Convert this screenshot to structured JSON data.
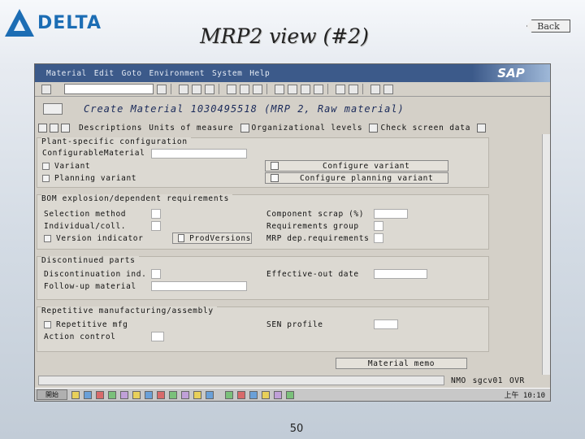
{
  "slide": {
    "logo_text": "DELTA",
    "title": "MRP2 view (#2)",
    "back_label": "Back",
    "page_number": "50"
  },
  "sap": {
    "menu": [
      "Material",
      "Edit",
      "Goto",
      "Environment",
      "System",
      "Help"
    ],
    "logo": "SAP",
    "screen_title": "Create Material 1030495518 (MRP 2, Raw material)",
    "app_toolbar": [
      "Descriptions",
      "Units of measure",
      "Organizational levels",
      "Check screen data"
    ],
    "sections": {
      "plant": {
        "title": "Plant-specific configuration",
        "configurable_material": "ConfigurableMaterial",
        "variant": "Variant",
        "planning_variant": "Planning variant",
        "configure_variant": "Configure variant",
        "configure_planning_variant": "Configure planning variant"
      },
      "bom": {
        "title": "BOM explosion/dependent requirements",
        "selection_method": "Selection method",
        "individual_coll": "Individual/coll.",
        "version_indicator": "Version indicator",
        "prod_versions": "ProdVersions",
        "component_scrap": "Component scrap (%)",
        "requirements_group": "Requirements group",
        "mrp_dep_requirements": "MRP dep.requirements"
      },
      "discontinued": {
        "title": "Discontinued parts",
        "discontinuation_ind": "Discontinuation ind.",
        "follow_up_material": "Follow-up material",
        "effective_out_date": "Effective-out date"
      },
      "repetitive": {
        "title": "Repetitive manufacturing/assembly",
        "repetitive_mfg": "Repetitive mfg",
        "action_control": "Action control",
        "sen_profile": "SEN profile"
      }
    },
    "material_memo": "Material memo",
    "status": {
      "system": "NMO",
      "server": "sgcv01",
      "mode": "OVR"
    },
    "taskbar": {
      "start_label": "開始",
      "clock": "上午 10:10"
    }
  }
}
